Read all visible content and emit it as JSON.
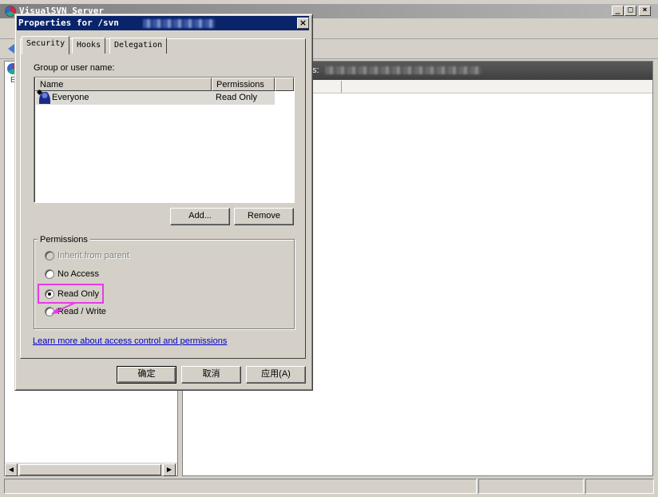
{
  "main_window": {
    "title": "VisualSVN Server",
    "minimize_glyph": "_",
    "maximize_glyph": "□",
    "close_glyph": "×",
    "left_node_label": "E",
    "right_header_text": "s:",
    "scroll_left_glyph": "◀",
    "scroll_right_glyph": "▶"
  },
  "dialog": {
    "title": "Properties for /svn",
    "close_glyph": "×",
    "tabs": [
      {
        "label": "Security",
        "active": true
      },
      {
        "label": "Hooks",
        "active": false
      },
      {
        "label": "Delegation",
        "active": false
      }
    ],
    "group_label": "Group or user name:",
    "columns": [
      "Name",
      "Permissions"
    ],
    "rows": [
      {
        "name": "Everyone",
        "permission": "Read Only"
      }
    ],
    "add_button": "Add...",
    "remove_button": "Remove",
    "permissions_group": "Permissions",
    "options": [
      {
        "label": "Inherit from parent",
        "enabled": false,
        "selected": false
      },
      {
        "label": "No Access",
        "enabled": true,
        "selected": false
      },
      {
        "label": "Read Only",
        "enabled": true,
        "selected": true
      },
      {
        "label": "Read / Write",
        "enabled": true,
        "selected": false
      }
    ],
    "learn_more_link": "Learn more about access control and permissions",
    "ok_button": "确定",
    "cancel_button": "取消",
    "apply_button": "应用(A)"
  },
  "colors": {
    "dialog_title_bg": "#0a246a",
    "highlight": "#e83aea",
    "link": "#0000cc",
    "window_bg": "#d4d0c8"
  }
}
